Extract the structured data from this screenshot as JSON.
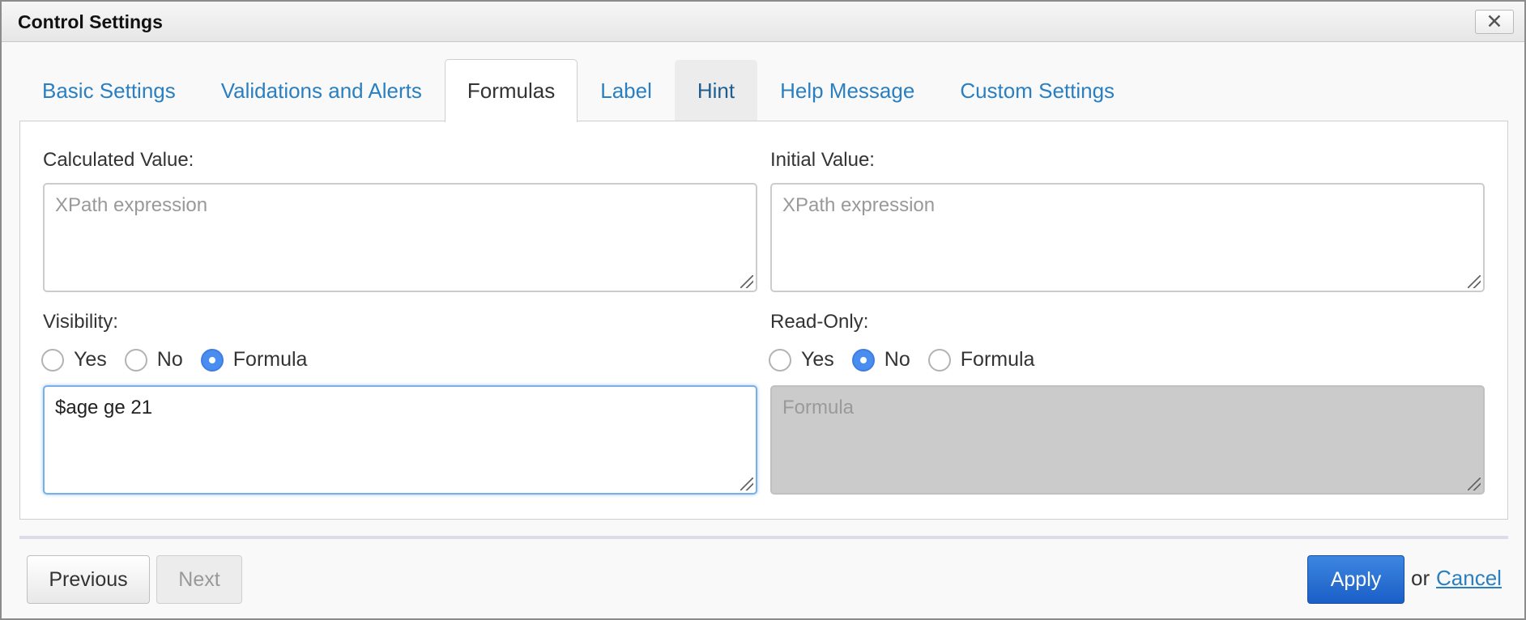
{
  "dialog": {
    "title": "Control Settings",
    "close_icon": "close-icon"
  },
  "tabs": [
    {
      "label": "Basic Settings",
      "state": "normal"
    },
    {
      "label": "Validations and Alerts",
      "state": "normal"
    },
    {
      "label": "Formulas",
      "state": "active"
    },
    {
      "label": "Label",
      "state": "normal"
    },
    {
      "label": "Hint",
      "state": "hover"
    },
    {
      "label": "Help Message",
      "state": "normal"
    },
    {
      "label": "Custom Settings",
      "state": "normal"
    }
  ],
  "formulas": {
    "calculated_value": {
      "label": "Calculated Value:",
      "placeholder": "XPath expression",
      "value": ""
    },
    "initial_value": {
      "label": "Initial Value:",
      "placeholder": "XPath expression",
      "value": ""
    },
    "visibility": {
      "label": "Visibility:",
      "options": [
        "Yes",
        "No",
        "Formula"
      ],
      "selected": "Formula",
      "formula_value": "$age ge 21"
    },
    "read_only": {
      "label": "Read-Only:",
      "options": [
        "Yes",
        "No",
        "Formula"
      ],
      "selected": "No",
      "formula_placeholder": "Formula"
    }
  },
  "footer": {
    "previous_label": "Previous",
    "next_label": "Next",
    "apply_label": "Apply",
    "or_text": "or",
    "cancel_label": "Cancel"
  },
  "colors": {
    "accent": "#2a7fc1",
    "primary_button": "#1a5fc7",
    "radio_checked": "#4a8df0"
  }
}
